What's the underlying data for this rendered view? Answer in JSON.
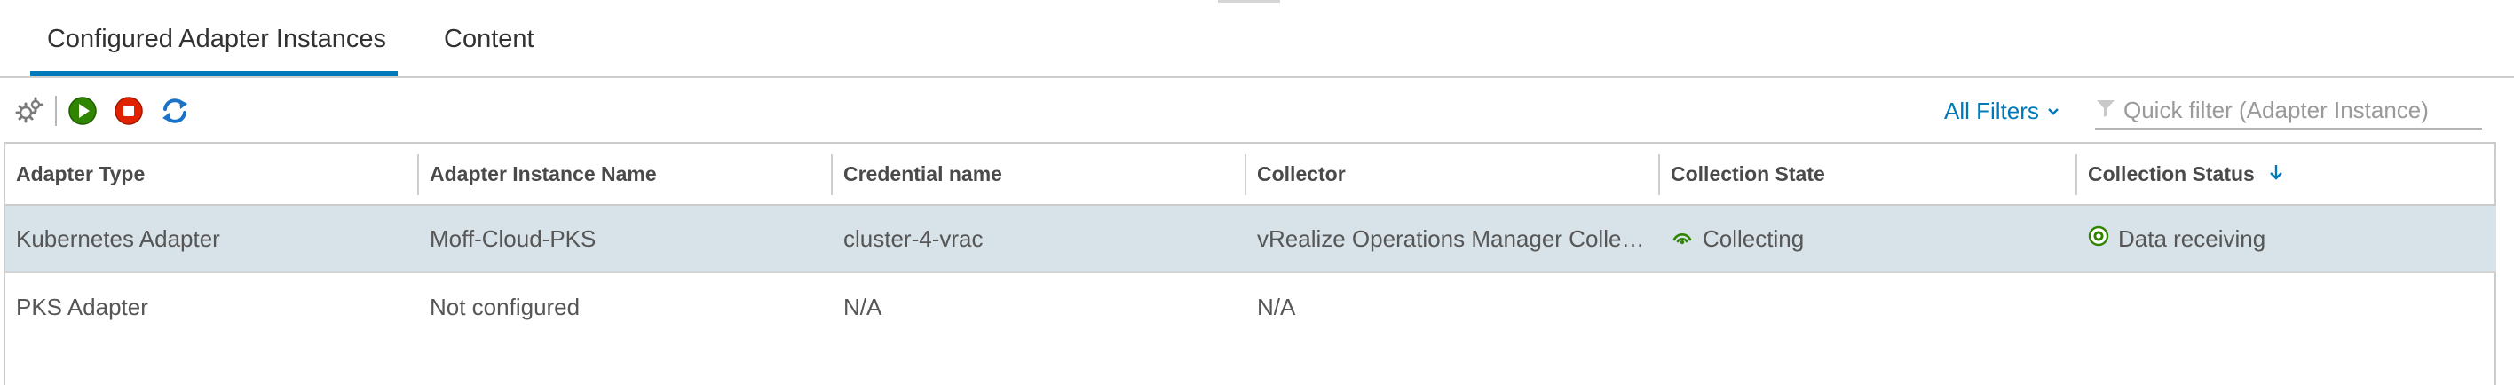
{
  "tabs": {
    "adapter_instances": "Configured Adapter Instances",
    "content": "Content"
  },
  "toolbar": {
    "icons": [
      "configure-icon",
      "start-icon",
      "stop-icon",
      "refresh-icon"
    ],
    "filters_label": "All Filters",
    "quick_filter_placeholder": "Quick filter (Adapter Instance)",
    "quick_filter_value": ""
  },
  "table": {
    "columns": [
      "Adapter Type",
      "Adapter Instance Name",
      "Credential name",
      "Collector",
      "Collection State",
      "Collection Status"
    ],
    "sorted_column": "Collection Status",
    "sort_direction": "descending",
    "rows": [
      {
        "adapter_type": "Kubernetes Adapter",
        "instance_name": "Moff-Cloud-PKS",
        "credential": "cluster-4-vrac",
        "collector": "vRealize Operations Manager Collector",
        "state": "Collecting",
        "status": "Data receiving",
        "selected": true
      },
      {
        "adapter_type": "PKS Adapter",
        "instance_name": "Not configured",
        "credential": "N/A",
        "collector": "N/A",
        "state": "",
        "status": "",
        "selected": false
      }
    ]
  },
  "colors": {
    "accent": "#0079b8",
    "selected_row": "#d8e3e9",
    "status_ok": "#2f8400",
    "stop": "#e12200",
    "start": "#2f8400"
  }
}
